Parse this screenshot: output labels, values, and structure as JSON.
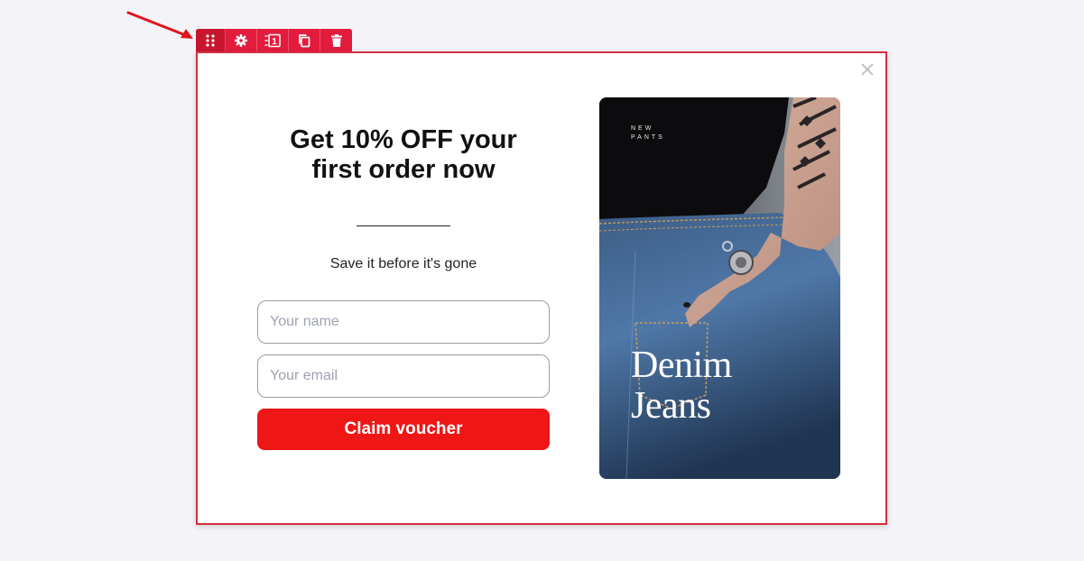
{
  "toolbar": {
    "items": [
      {
        "name": "drag-handle-icon"
      },
      {
        "name": "gear-icon"
      },
      {
        "name": "step-icon",
        "label": "1"
      },
      {
        "name": "duplicate-icon"
      },
      {
        "name": "trash-icon"
      }
    ],
    "color": "#e31b3d"
  },
  "popup": {
    "title_line1": "Get 10% OFF your",
    "title_line2": "first order now",
    "subtitle": "Save it before it's gone",
    "name_placeholder": "Your name",
    "email_placeholder": "Your email",
    "button_label": "Claim voucher",
    "button_color": "#ef1616",
    "close_icon": "close-icon"
  },
  "image": {
    "tag_line1": "NEW",
    "tag_line2": "PANTS",
    "headline_line1": "Denim",
    "headline_line2": "Jeans"
  }
}
